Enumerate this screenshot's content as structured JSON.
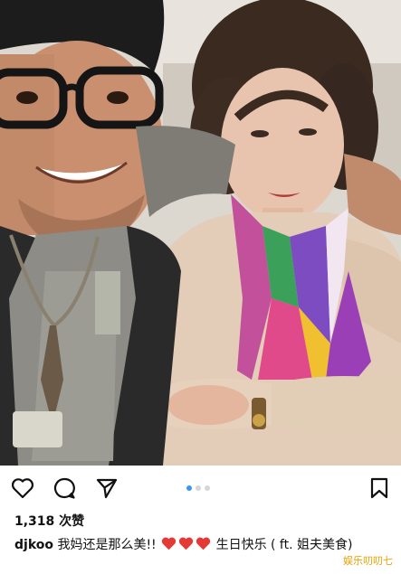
{
  "post": {
    "likes": "1,318 次赞",
    "username": "djkoo",
    "caption_part1": " 我妈还是那么美!! ",
    "caption_part2": " 生日快乐 ( ft. 姐夫美食)",
    "carousel": {
      "total": 3,
      "active_index": 0
    }
  },
  "actions": {
    "like_icon": "heart-outline-icon",
    "comment_icon": "comment-bubble-icon",
    "share_icon": "send-paper-plane-icon",
    "save_icon": "bookmark-icon"
  },
  "emoji": {
    "heart_color": "#e53935",
    "count": 3
  },
  "watermark": {
    "text": "娱乐叨叨七"
  },
  "colors": {
    "carousel_active": "#3897f0",
    "carousel_inactive": "#d6d6d6"
  }
}
